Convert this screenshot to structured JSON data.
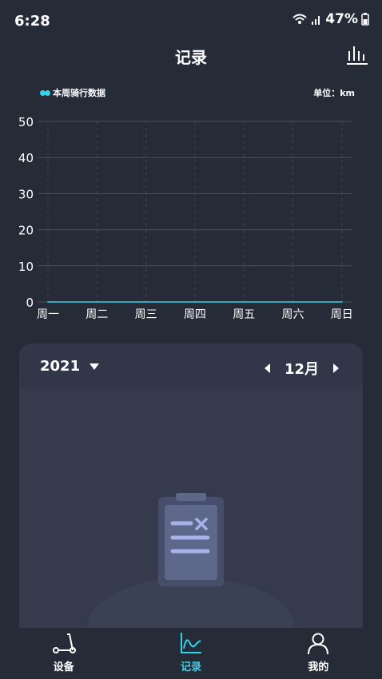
{
  "status": {
    "time": "6:28",
    "battery": "47%"
  },
  "header": {
    "title": "记录"
  },
  "legend": {
    "label": "本周骑行数据"
  },
  "unit": "单位：km",
  "chart_data": {
    "type": "line",
    "categories": [
      "周一",
      "周二",
      "周三",
      "周四",
      "周五",
      "周六",
      "周日"
    ],
    "series": [
      {
        "name": "本周骑行数据",
        "values": [
          0,
          0,
          0,
          0,
          0,
          0,
          0
        ]
      }
    ],
    "y_ticks": [
      "0",
      "10",
      "20",
      "30",
      "40",
      "50"
    ],
    "ylim": [
      0,
      50
    ],
    "grid": true,
    "color": "#33d3e9"
  },
  "calendar": {
    "year": "2021",
    "month": "12月"
  },
  "tabs": [
    {
      "label": "设备",
      "icon": "scooter-icon",
      "active": false
    },
    {
      "label": "记录",
      "icon": "chart-line-icon",
      "active": true
    },
    {
      "label": "我的",
      "icon": "user-icon",
      "active": false
    }
  ],
  "colors": {
    "background": "#262b38",
    "accent": "#33d3e9",
    "card": "#353b4c"
  }
}
